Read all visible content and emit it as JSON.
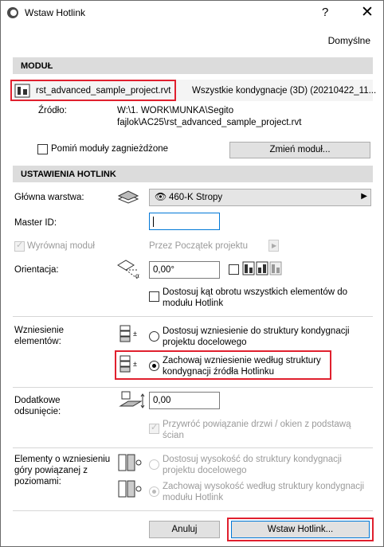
{
  "window": {
    "title": "Wstaw Hotlink",
    "help_label": "?",
    "close_label": "✕"
  },
  "default_label": "Domyślne",
  "module": {
    "header": "MODUŁ",
    "file_name": "rst_advanced_sample_project.rvt",
    "story_info": "Wszystkie kondygnacje (3D) (20210422_11...",
    "source_label": "Źródło:",
    "source_line1": "W:\\1. WORK\\MUNKA\\Segito",
    "source_line2": "fajlok\\AC25\\rst_advanced_sample_project.rvt",
    "skip_nested_label": "Pomiń moduły zagnieżdżone",
    "change_module_button": "Zmień moduł..."
  },
  "settings": {
    "header": "USTAWIENIA HOTLINK",
    "main_layer_label": "Główna warstwa:",
    "main_layer_value": "460-K Stropy",
    "master_id_label": "Master ID:",
    "master_id_value": "",
    "align_module_label": "Wyrównaj moduł",
    "align_module_value": "Przez Początek projektu",
    "orientation_label": "Orientacja:",
    "orientation_value": "0,00°",
    "adjust_rotation_line1": "Dostosuj kąt obrotu wszystkich elementów do",
    "adjust_rotation_line2": "modułu Hotlink",
    "elevation_label_line1": "Wzniesienie",
    "elevation_label_line2": "elementów:",
    "elev_opt1_line1": "Dostosuj wzniesienie do struktury kondygnacji",
    "elev_opt1_line2": "projektu docelowego",
    "elev_opt2_line1": "Zachowaj wzniesienie według struktury",
    "elev_opt2_line2": "kondygnacji źródła Hotlinku",
    "offset_label_line1": "Dodatkowe",
    "offset_label_line2": "odsunięcie:",
    "offset_value": "0,00",
    "restore_line1": "Przywróć powiązanie drzwi / okien z podstawą",
    "restore_line2": "ścian",
    "top_label_line1": "Elementy o wzniesieniu",
    "top_label_line2": "góry powiązanej z",
    "top_label_line3": "poziomami:",
    "top_opt1_line1": "Dostosuj wysokość do struktury kondygnacji",
    "top_opt1_line2": "projektu docelowego",
    "top_opt2_line1": "Zachowaj wysokość według struktury kondygnacji",
    "top_opt2_line2": "modułu Hotlink"
  },
  "footer": {
    "cancel_button": "Anuluj",
    "insert_button": "Wstaw Hotlink..."
  },
  "colors": {
    "highlight": "#e0202e",
    "focus_border": "#0078d7"
  }
}
